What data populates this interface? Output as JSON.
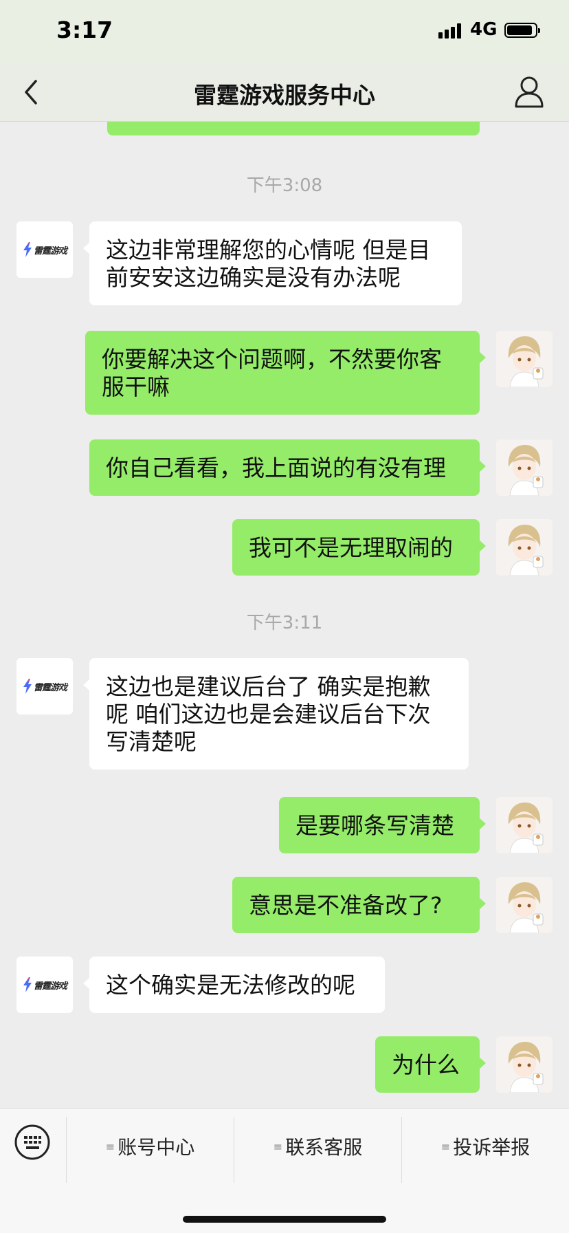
{
  "status_bar": {
    "time": "3:17",
    "network": "4G"
  },
  "nav": {
    "title": "雷霆游戏服务中心"
  },
  "service_logo_text": "雷霆游戏",
  "messages": [
    {
      "type": "timestamp",
      "text": "下午3:08"
    },
    {
      "type": "incoming",
      "text": "这边非常理解您的心情呢 但是目前安安这边确实是没有办法呢"
    },
    {
      "type": "outgoing",
      "text": "你要解决这个问题啊，不然要你客服干嘛"
    },
    {
      "type": "outgoing",
      "text": "你自己看看，我上面说的有没有理"
    },
    {
      "type": "outgoing",
      "text": "我可不是无理取闹的"
    },
    {
      "type": "timestamp",
      "text": "下午3:11"
    },
    {
      "type": "incoming",
      "text": "这边也是建议后台了  确实是抱歉呢 咱们这边也是会建议后台下次写清楚呢"
    },
    {
      "type": "outgoing",
      "text": "是要哪条写清楚"
    },
    {
      "type": "outgoing",
      "text": "意思是不准备改了?"
    },
    {
      "type": "incoming",
      "text": "这个确实是无法修改的呢"
    },
    {
      "type": "outgoing",
      "text": "为什么"
    }
  ],
  "menu": {
    "items": [
      "账号中心",
      "联系客服",
      "投诉举报"
    ]
  }
}
